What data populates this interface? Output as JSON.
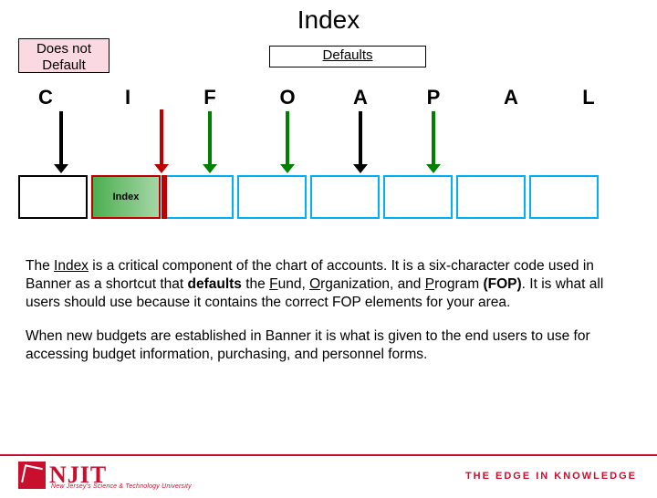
{
  "title": "Index",
  "boxes": {
    "does_not": "Does not\nDefault",
    "defaults": "Defaults"
  },
  "letters": [
    "C",
    "I",
    "F",
    "O",
    "A",
    "P",
    "A",
    "L"
  ],
  "index_label": "Index",
  "paragraph1_parts": {
    "p1": "The ",
    "p2": "Index",
    "p3": " is a critical component of the chart of accounts.  It is a six-character code used in Banner as a shortcut that ",
    "p4": "defaults",
    "p5": " the ",
    "p6": "F",
    "p7": "und, ",
    "p8": "O",
    "p9": "rganization, and ",
    "p10": "P",
    "p11": "rogram ",
    "p12": "(FOP)",
    "p13": ".  It is what all users should use because it contains the correct FOP elements for your area."
  },
  "paragraph2": "When new budgets are established in Banner it is what is given to the end users to use for accessing budget information, purchasing, and personnel forms.",
  "footer": {
    "logo_text": "NJIT",
    "logo_sub": "New Jersey's Science & Technology University",
    "edge": "THE EDGE IN KNOWLEDGE"
  }
}
